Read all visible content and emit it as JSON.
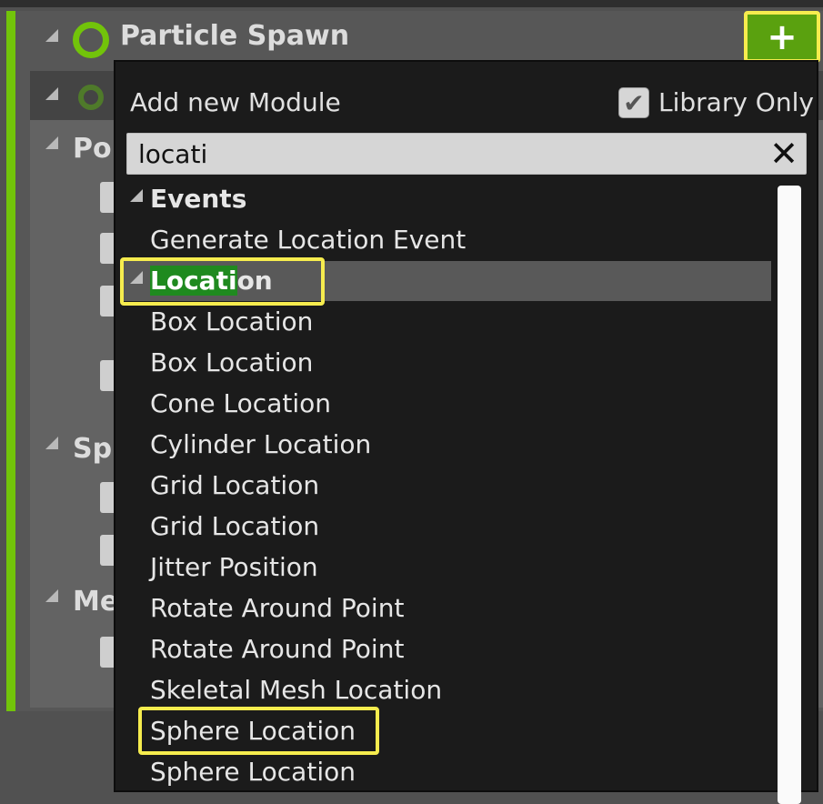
{
  "stack": {
    "title": "Particle Spawn",
    "add_button_icon": "plus-icon",
    "partial_labels": [
      "Poi",
      "Spr",
      "Me"
    ]
  },
  "dropdown": {
    "title": "Add new Module",
    "library_only_label": "Library Only",
    "library_only_checked": true,
    "search_value": "locati",
    "search_clear_icon": "close-icon",
    "categories": [
      {
        "name": "Events",
        "items": [
          "Generate Location Event"
        ]
      },
      {
        "name_highlight": "Locati",
        "name_rest": "on",
        "items": [
          "Box Location",
          "Box Location",
          "Cone Location",
          "Cylinder Location",
          "Grid Location",
          "Grid Location",
          "Jitter Position",
          "Rotate Around Point",
          "Rotate Around Point",
          "Skeletal Mesh Location",
          "Sphere Location",
          "Sphere Location"
        ]
      }
    ]
  },
  "colors": {
    "accent_green": "#72c40a",
    "highlight_yellow": "#f6ec4e",
    "match_green": "#1f8a1f"
  }
}
